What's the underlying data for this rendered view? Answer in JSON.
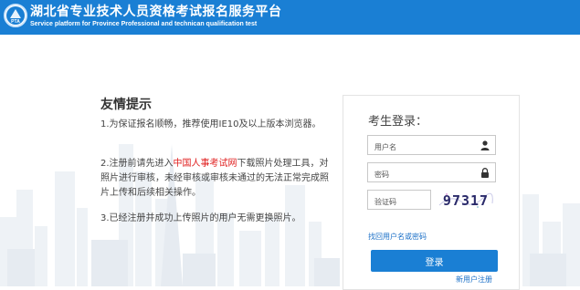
{
  "header": {
    "title": "湖北省专业技术人员资格考试报名服务平台",
    "subtitle": "Service platform for Province Professional and technican qualification test",
    "logo_text": "PTA",
    "brand_color": "#1a7fd4"
  },
  "notice": {
    "title": "友情提示",
    "item1": "1.为保证报名顺畅，推荐使用IE10及以上版本浏览器。",
    "item2_before": "2.注册前请先进入",
    "item2_link": "中国人事考试网",
    "item2_after": "下载照片处理工具，对照片进行审核，未经审核或审核未通过的无法正常完成照片上传和后续相关操作。",
    "item3": "3.已经注册并成功上传照片的用户无需更换照片。"
  },
  "login": {
    "title": "考生登录：",
    "username_placeholder": "用户名",
    "password_placeholder": "密码",
    "captcha_placeholder": "验证码",
    "captcha_code": "97317",
    "forgot_link": "找回用户名或密码",
    "login_button": "登录",
    "register_link": "新用户注册"
  },
  "icons": {
    "username": "user-icon",
    "password": "lock-icon"
  }
}
